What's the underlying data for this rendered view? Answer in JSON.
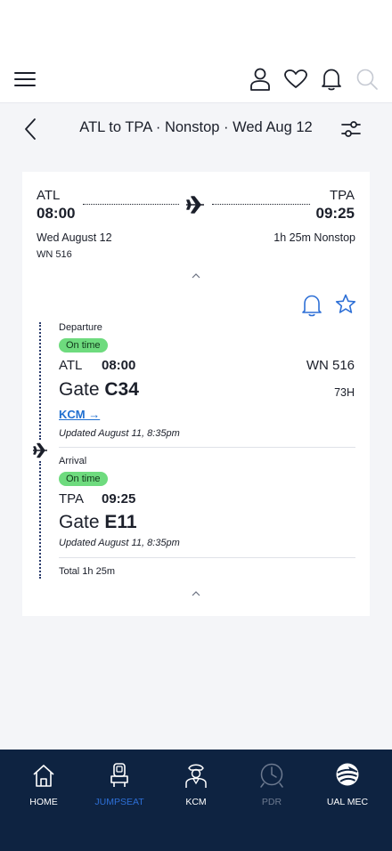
{
  "header": {
    "icons": [
      "menu-icon",
      "user-icon",
      "heart-icon",
      "bell-icon",
      "search-icon"
    ]
  },
  "subheader": {
    "title": "ATL to TPA · Nonstop · Wed Aug 12"
  },
  "summary": {
    "origin": "ATL",
    "destination": "TPA",
    "depart_time": "08:00",
    "arrive_time": "09:25",
    "date": "Wed August 12",
    "duration": "1h 25m Nonstop",
    "flight_number": "WN 516"
  },
  "departure": {
    "label": "Departure",
    "status": "On time",
    "airport": "ATL",
    "time": "08:00",
    "flight": "WN 516",
    "gate_label": "Gate",
    "gate": "C34",
    "seat": "73H",
    "link": "KCM →",
    "updated": "Updated August 11, 8:35pm"
  },
  "arrival": {
    "label": "Arrival",
    "status": "On time",
    "airport": "TPA",
    "time": "09:25",
    "gate_label": "Gate",
    "gate": "E11",
    "updated": "Updated August 11, 8:35pm"
  },
  "total": "Total 1h 25m",
  "bottom_nav": {
    "items": [
      {
        "label": "HOME",
        "icon": "home-icon",
        "color": "#ffffff"
      },
      {
        "label": "JUMPSEAT",
        "icon": "seat-icon",
        "color": "#2d6fd6"
      },
      {
        "label": "KCM",
        "icon": "pilot-icon",
        "color": "#ffffff"
      },
      {
        "label": "PDR",
        "icon": "clock-icon",
        "color": "#6d7a90"
      },
      {
        "label": "UAL MEC",
        "icon": "globe-icon",
        "color": "#ffffff"
      }
    ]
  },
  "colors": {
    "accent": "#1f6fd0",
    "badge": "#6edb7e",
    "nav_bg": "#0e2341",
    "timeline": "#2a3b6b"
  }
}
